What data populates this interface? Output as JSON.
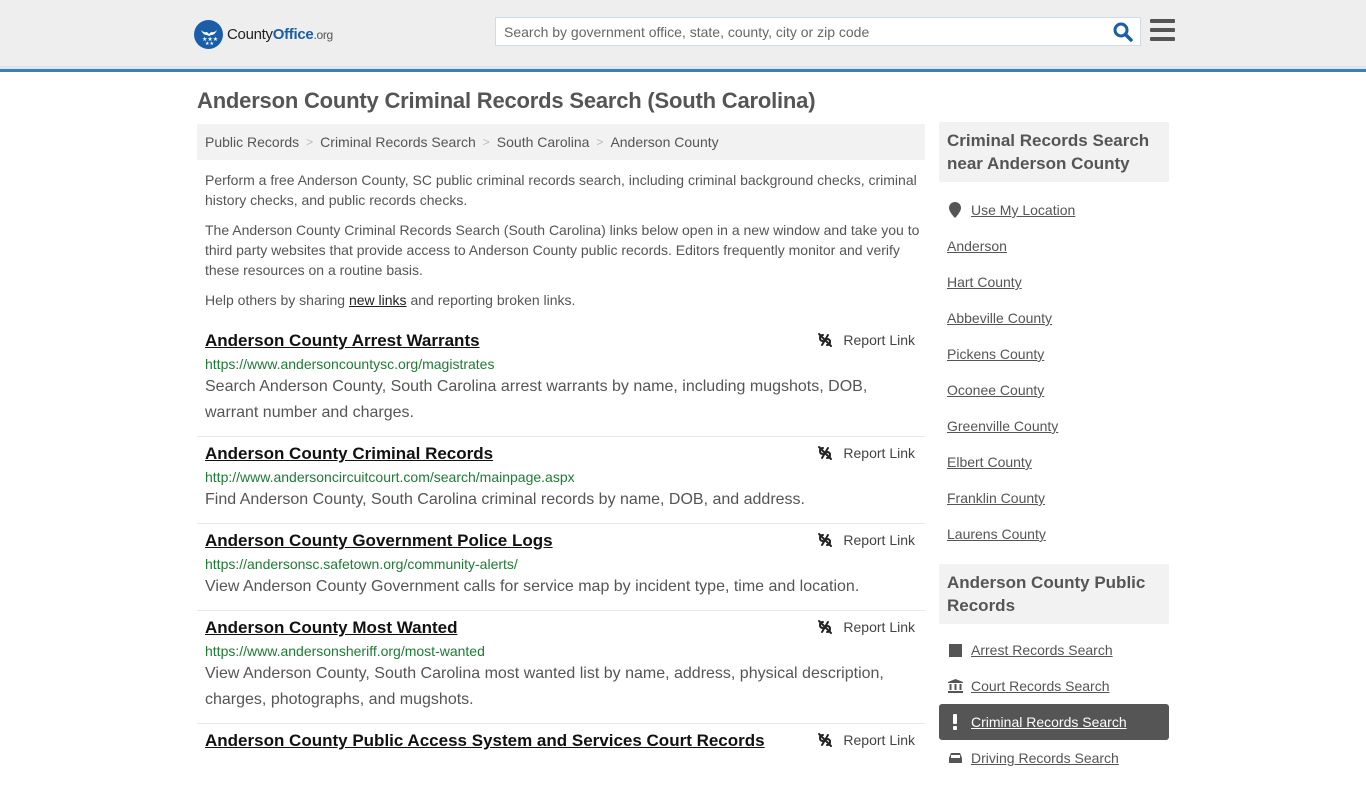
{
  "header": {
    "logo": {
      "brand_prefix": "County",
      "brand_main": "Office",
      "brand_suffix": ".org"
    },
    "search": {
      "placeholder": "Search by government office, state, county, city or zip code",
      "value": ""
    },
    "icons": {
      "search": "search-icon",
      "menu": "hamburger-menu-icon"
    },
    "colors": {
      "accent": "#3a7fb3",
      "brand": "#1a5ea8"
    }
  },
  "page": {
    "title": "Anderson County Criminal Records Search (South Carolina)",
    "breadcrumb": [
      "Public Records",
      "Criminal Records Search",
      "South Carolina",
      "Anderson County"
    ],
    "intro": {
      "p1": "Perform a free Anderson County, SC public criminal records search, including criminal background checks, criminal history checks, and public records checks.",
      "p2": "The Anderson County Criminal Records Search (South Carolina) links below open in a new window and take you to third party websites that provide access to Anderson County public records. Editors frequently monitor and verify these resources on a routine basis.",
      "p3_before": "Help others by sharing ",
      "p3_link": "new links",
      "p3_after": " and reporting broken links."
    }
  },
  "results": [
    {
      "title": "Anderson County Arrest Warrants",
      "url": "https://www.andersoncountysc.org/magistrates",
      "description": "Search Anderson County, South Carolina arrest warrants by name, including mugshots, DOB, warrant number and charges.",
      "report_label": "Report Link"
    },
    {
      "title": "Anderson County Criminal Records",
      "url": "http://www.andersoncircuitcourt.com/search/mainpage.aspx",
      "description": "Find Anderson County, South Carolina criminal records by name, DOB, and address.",
      "report_label": "Report Link"
    },
    {
      "title": "Anderson County Government Police Logs",
      "url": "https://andersonsc.safetown.org/community-alerts/",
      "description": "View Anderson County Government calls for service map by incident type, time and location.",
      "report_label": "Report Link"
    },
    {
      "title": "Anderson County Most Wanted",
      "url": "https://www.andersonsheriff.org/most-wanted",
      "description": "View Anderson County, South Carolina most wanted list by name, address, physical description, charges, photographs, and mugshots.",
      "report_label": "Report Link"
    },
    {
      "title": "Anderson County Public Access System and Services Court Records",
      "url": "",
      "description": "",
      "report_label": "Report Link"
    }
  ],
  "sidebar": {
    "nearby": {
      "heading": "Criminal Records Search near Anderson County",
      "use_location": "Use My Location",
      "items": [
        "Anderson",
        "Hart County",
        "Abbeville County",
        "Pickens County",
        "Oconee County",
        "Greenville County",
        "Elbert County",
        "Franklin County",
        "Laurens County"
      ]
    },
    "public_records": {
      "heading": "Anderson County Public Records",
      "items": [
        {
          "label": "Arrest Records Search",
          "icon": "square-icon",
          "active": false
        },
        {
          "label": "Court Records Search",
          "icon": "courthouse-icon",
          "active": false
        },
        {
          "label": "Criminal Records Search",
          "icon": "exclamation-icon",
          "active": true
        },
        {
          "label": "Driving Records Search",
          "icon": "car-icon",
          "active": false
        }
      ]
    }
  }
}
